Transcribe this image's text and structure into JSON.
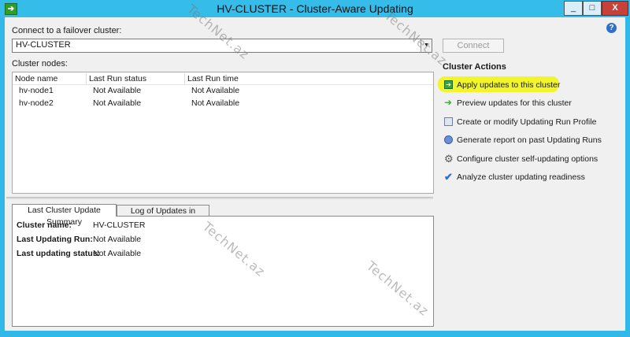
{
  "window": {
    "title": "HV-CLUSTER - Cluster-Aware Updating",
    "minimize_glyph": "_",
    "maximize_glyph": "□",
    "close_glyph": "X"
  },
  "connect": {
    "label": "Connect to a failover cluster:",
    "value": "HV-CLUSTER",
    "button_label": "Connect"
  },
  "nodes": {
    "label": "Cluster nodes:",
    "columns": [
      "Node name",
      "Last Run status",
      "Last Run time"
    ],
    "rows": [
      {
        "name": "hv-node1",
        "status": "Not Available",
        "time": "Not Available"
      },
      {
        "name": "hv-node2",
        "status": "Not Available",
        "time": "Not Available"
      }
    ]
  },
  "tabs": [
    {
      "label": "Last Cluster Update Summary",
      "active": true
    },
    {
      "label": "Log of Updates in Progress",
      "active": false
    }
  ],
  "summary": [
    {
      "key": "Cluster name:",
      "value": "HV-CLUSTER"
    },
    {
      "key": "Last Updating Run:",
      "value": "Not Available"
    },
    {
      "key": "Last updating status:",
      "value": "Not Available"
    }
  ],
  "actions": {
    "heading": "Cluster Actions",
    "items": [
      {
        "label": "Apply updates to this cluster",
        "icon": "apply-updates-icon",
        "highlighted": true
      },
      {
        "label": "Preview updates for this cluster",
        "icon": "green-arrow-icon"
      },
      {
        "label": "Create or modify Updating Run Profile",
        "icon": "profile-document-icon"
      },
      {
        "label": "Generate report on past Updating Runs",
        "icon": "report-icon"
      },
      {
        "label": "Configure cluster self-updating options",
        "icon": "gear-icon"
      },
      {
        "label": "Analyze cluster updating readiness",
        "icon": "checkmark-icon"
      }
    ]
  },
  "watermark": "TechNet.az",
  "colors": {
    "titlebar": "#36bce9",
    "highlight": "#f1f52a",
    "close_button": "#c7413a"
  }
}
